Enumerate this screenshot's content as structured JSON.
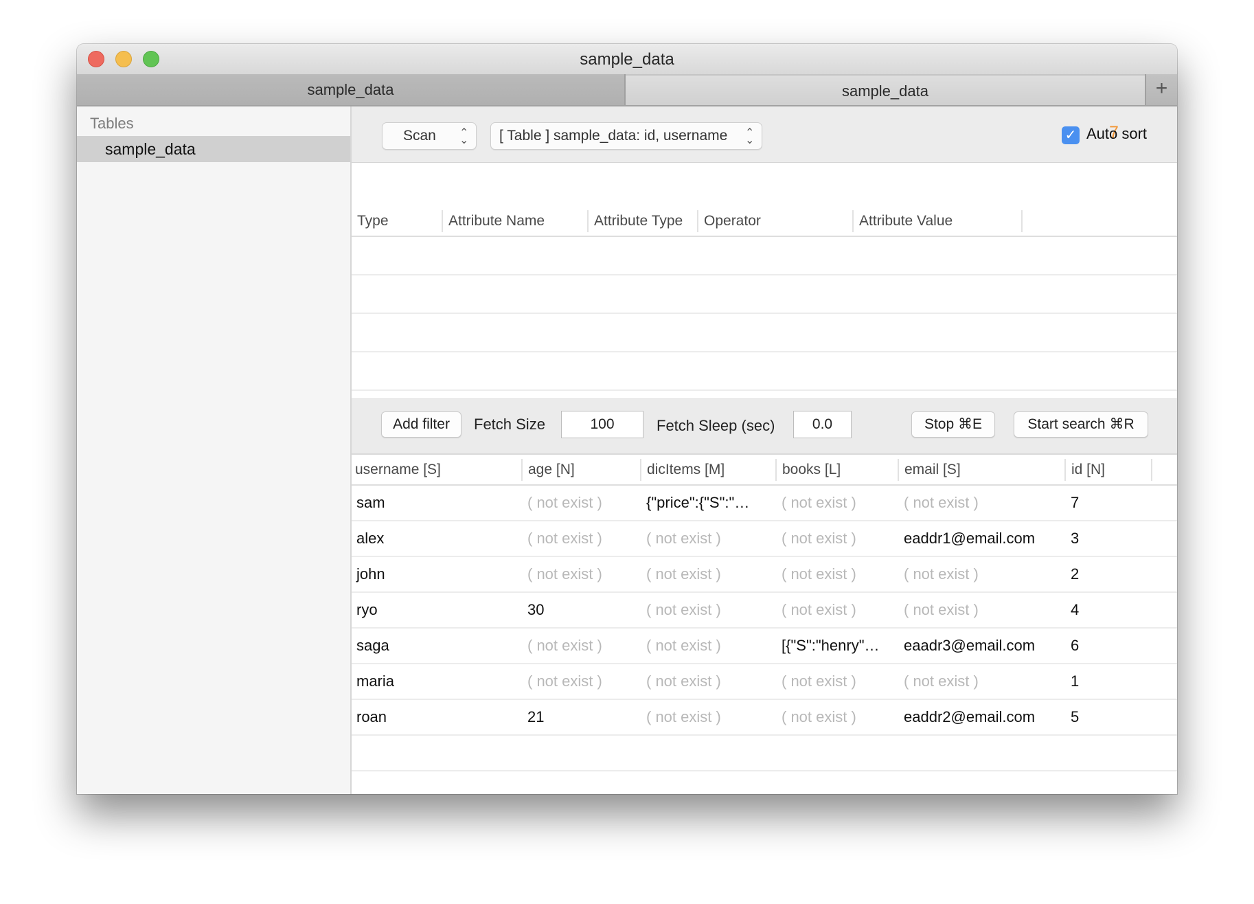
{
  "window": {
    "title": "sample_data",
    "controls": [
      "close",
      "minimize",
      "zoom"
    ]
  },
  "tabs": [
    {
      "label": "sample_data",
      "active": false
    },
    {
      "label": "sample_data",
      "active": true
    }
  ],
  "new_tab_icon": "plus-icon",
  "sidebar": {
    "header": "Tables",
    "items": [
      {
        "label": "sample_data",
        "selected": true
      }
    ]
  },
  "toolbar": {
    "mode": {
      "selected": "Scan",
      "icon": "up-down-chevron-icon"
    },
    "table": {
      "selected": "[ Table ] sample_data: id, username",
      "icon": "up-down-chevron-icon"
    },
    "result_count": "7",
    "result_count_color": "#f29533",
    "auto_sort": {
      "label": "Auto sort",
      "checked": true,
      "check_color": "#4a90f0"
    }
  },
  "filters": {
    "columns": [
      "Type",
      "Attribute Name",
      "Attribute Type",
      "Operator",
      "Attribute Value"
    ],
    "rows": []
  },
  "filterbar": {
    "add_filter": "Add filter",
    "fetch_size_label": "Fetch Size",
    "fetch_size_value": "100",
    "fetch_sleep_label": "Fetch Sleep (sec)",
    "fetch_sleep_value": "0.0",
    "stop": "Stop ⌘E",
    "start": "Start search ⌘R"
  },
  "results": {
    "missing_text": "( not exist )",
    "columns": [
      "username [S]",
      "age [N]",
      "dicItems [M]",
      "books [L]",
      "email [S]",
      "id [N]"
    ],
    "rows": [
      [
        "sam",
        null,
        "{\"price\":{\"S\":\"…",
        null,
        null,
        "7"
      ],
      [
        "alex",
        null,
        null,
        null,
        "eaddr1@email.com",
        "3"
      ],
      [
        "john",
        null,
        null,
        null,
        null,
        "2"
      ],
      [
        "ryo",
        "30",
        null,
        null,
        null,
        "4"
      ],
      [
        "saga",
        null,
        null,
        "[{\"S\":\"henry\"…",
        "eaadr3@email.com",
        "6"
      ],
      [
        "maria",
        null,
        null,
        null,
        null,
        "1"
      ],
      [
        "roan",
        "21",
        null,
        null,
        "eaddr2@email.com",
        "5"
      ]
    ]
  }
}
